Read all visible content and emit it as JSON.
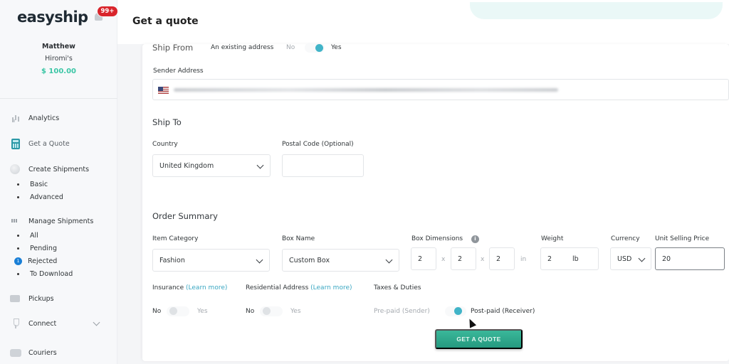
{
  "app": {
    "logo_text": "easyship",
    "notification_badge": "99+"
  },
  "user": {
    "name": "Matthew",
    "company": "Hiromi's",
    "balance": "$ 100.00"
  },
  "sidebar": {
    "items": [
      {
        "label": "Analytics",
        "icon": "analytics-icon"
      },
      {
        "label": "Get a Quote",
        "icon": "calculator-icon",
        "active": true
      },
      {
        "label": "Create Shipments",
        "icon": "box-icon",
        "children": [
          "Basic",
          "Advanced"
        ]
      },
      {
        "label": "Manage Shipments",
        "icon": "list-icon",
        "children": [
          "All",
          "Pending",
          "Rejected",
          "To Download"
        ],
        "rejected_count": "1"
      },
      {
        "label": "Pickups",
        "icon": "truck-icon"
      },
      {
        "label": "Connect",
        "icon": "plug-icon"
      },
      {
        "label": "Couriers",
        "icon": "courier-icon"
      }
    ]
  },
  "header": {
    "title": "Get a quote"
  },
  "ship_from": {
    "title": "Ship From",
    "existing_address_label": "An existing address",
    "toggle_off_label": "No",
    "toggle_on_label": "Yes",
    "toggle_value": "Yes",
    "sender_address_label": "Sender Address",
    "sender_address_value": "[redacted]",
    "sender_country_flag": "US"
  },
  "ship_to": {
    "title": "Ship To",
    "country_label": "Country",
    "country_value": "United Kingdom",
    "postal_label": "Postal Code (Optional)",
    "postal_value": ""
  },
  "order_summary": {
    "title": "Order Summary",
    "item_category_label": "Item Category",
    "item_category_value": "Fashion",
    "box_name_label": "Box Name",
    "box_name_value": "Custom Box",
    "box_dimensions_label": "Box Dimensions",
    "dim_length": "2",
    "dim_width": "2",
    "dim_height": "2",
    "dim_separator": "x",
    "dim_unit": "in",
    "weight_label": "Weight",
    "weight_value": "2",
    "weight_unit": "lb",
    "currency_label": "Currency",
    "currency_value": "USD",
    "unit_price_label": "Unit Selling Price",
    "unit_price_value": "20"
  },
  "options": {
    "insurance_label": "Insurance",
    "insurance_link": "(Learn more)",
    "insurance_off": "No",
    "insurance_on": "Yes",
    "insurance_value": "No",
    "residential_label": "Residential Address",
    "residential_link": "(Learn more)",
    "residential_off": "No",
    "residential_on": "Yes",
    "residential_value": "No",
    "taxes_label": "Taxes & Duties",
    "taxes_off": "Pre-paid (Sender)",
    "taxes_on": "Post-paid (Receiver)",
    "taxes_value": "Post-paid (Receiver)"
  },
  "actions": {
    "get_quote_label": "GET A QUOTE"
  },
  "colors": {
    "brand": "#2bb5a3",
    "cta": "#2fa98c",
    "toggle_on": "#41b4c8",
    "badge": "#d9242b",
    "link": "#3aa7c2"
  }
}
